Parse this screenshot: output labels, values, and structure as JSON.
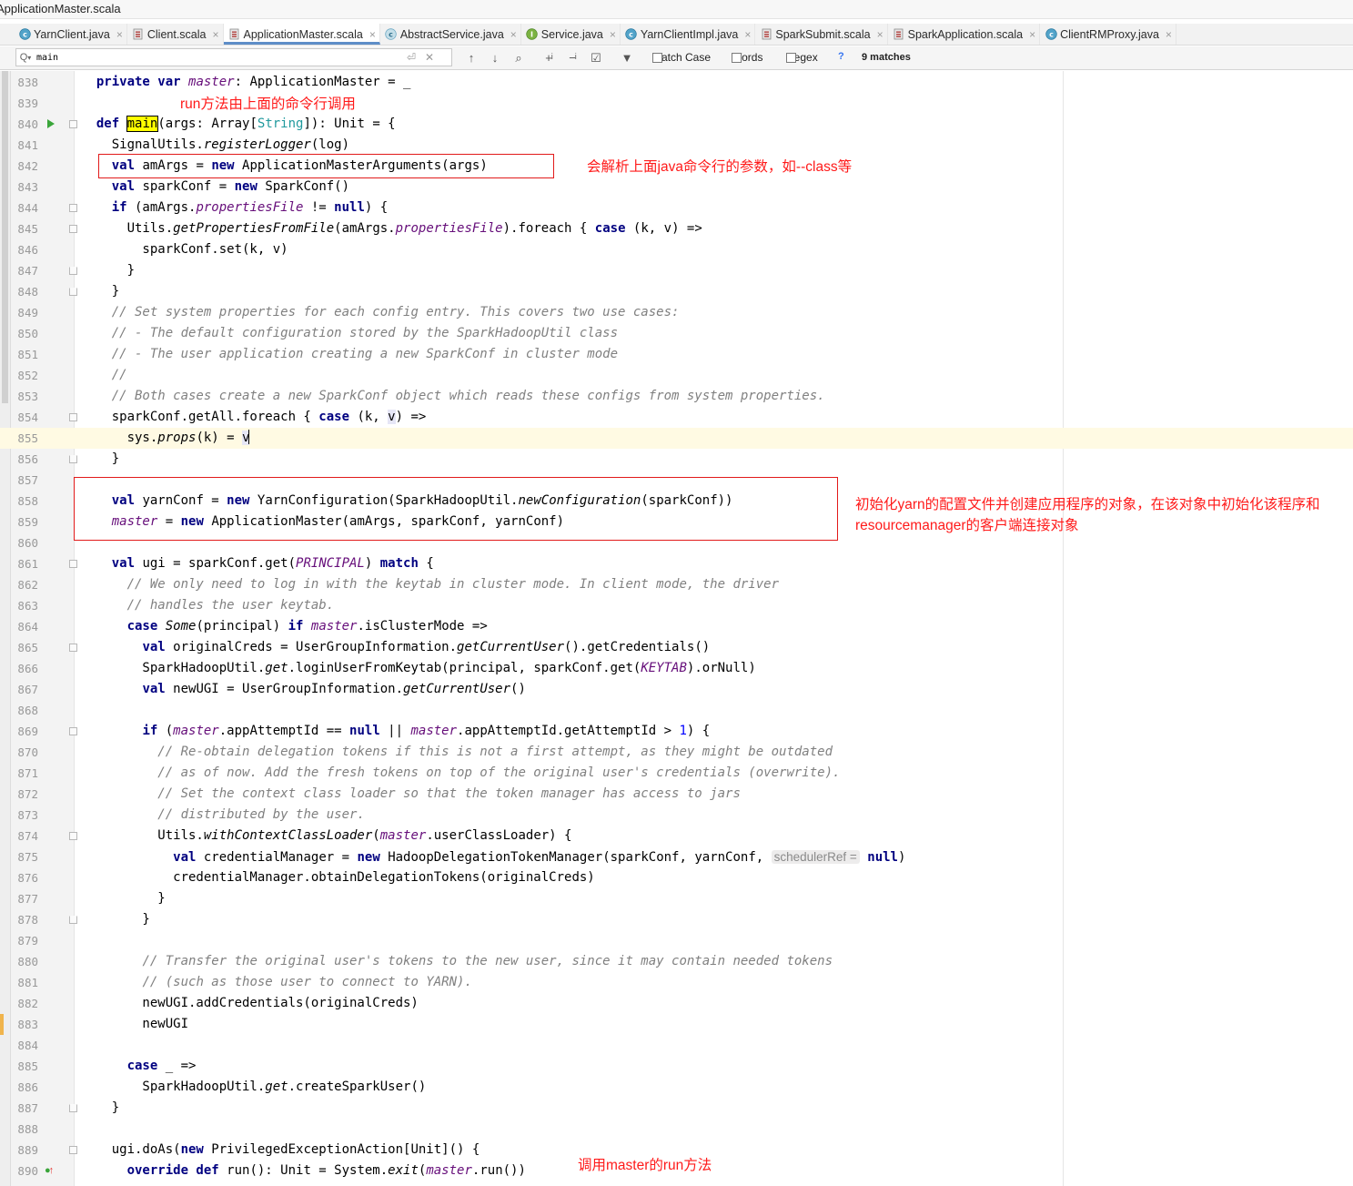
{
  "window": {
    "title": "ApplicationMaster.scala"
  },
  "tabs": [
    {
      "label": "YarnClient.java",
      "icon": "class-icon",
      "active": false
    },
    {
      "label": "Client.scala",
      "icon": "scala-file-icon",
      "active": false
    },
    {
      "label": "ApplicationMaster.scala",
      "icon": "scala-file-icon",
      "active": true
    },
    {
      "label": "AbstractService.java",
      "icon": "abstract-class-icon",
      "active": false
    },
    {
      "label": "Service.java",
      "icon": "interface-icon",
      "active": false
    },
    {
      "label": "YarnClientImpl.java",
      "icon": "class-icon",
      "active": false
    },
    {
      "label": "SparkSubmit.scala",
      "icon": "scala-file-icon",
      "active": false
    },
    {
      "label": "SparkApplication.scala",
      "icon": "scala-file-icon",
      "active": false
    },
    {
      "label": "ClientRMProxy.java",
      "icon": "class-icon",
      "active": false
    }
  ],
  "search": {
    "query": "main",
    "match_case_label": "Match Case",
    "words_label": "Words",
    "regex_label": "Regex",
    "help_label": "?",
    "matches_label": "9 matches"
  },
  "editor": {
    "current_line": 855,
    "lines": [
      {
        "n": "838",
        "html": "  <span class=\"kw\">private var</span> <span class=\"mem\">master</span>: ApplicationMaster = _"
      },
      {
        "n": "839",
        "html": ""
      },
      {
        "n": "840",
        "html": "  <span class=\"kw\">def</span> <span class=\"hl\">main</span>(args: Array[<span class=\"ty\">String</span>]): Unit = {"
      },
      {
        "n": "841",
        "html": "    SignalUtils.<span class=\"fn\">registerLogger</span>(log)"
      },
      {
        "n": "842",
        "html": "    <span class=\"kw\">val</span> amArgs = <span class=\"kw\">new</span> ApplicationMasterArguments(args)"
      },
      {
        "n": "843",
        "html": "    <span class=\"kw\">val</span> sparkConf = <span class=\"kw\">new</span> SparkConf()"
      },
      {
        "n": "844",
        "html": "    <span class=\"kw\">if</span> (amArgs.<span class=\"mem\">propertiesFile</span> != <span class=\"kw\">null</span>) {"
      },
      {
        "n": "845",
        "html": "      Utils.<span class=\"fn\">getPropertiesFromFile</span>(amArgs.<span class=\"mem\">propertiesFile</span>).foreach { <span class=\"kw\">case</span> (k, v) =>"
      },
      {
        "n": "846",
        "html": "        sparkConf.set(k, v)"
      },
      {
        "n": "847",
        "html": "      }"
      },
      {
        "n": "848",
        "html": "    }"
      },
      {
        "n": "849",
        "html": "    <span class=\"cm\">// Set system properties for each config entry. This covers two use cases:</span>"
      },
      {
        "n": "850",
        "html": "    <span class=\"cm\">// - The default configuration stored by the SparkHadoopUtil class</span>"
      },
      {
        "n": "851",
        "html": "    <span class=\"cm\">// - The user application creating a new SparkConf in cluster mode</span>"
      },
      {
        "n": "852",
        "html": "    <span class=\"cm\">//</span>"
      },
      {
        "n": "853",
        "html": "    <span class=\"cm\">// Both cases create a new SparkConf object which reads these configs from system properties.</span>"
      },
      {
        "n": "854",
        "html": "    sparkConf.getAll.foreach { <span class=\"kw\">case</span> (k, <span class=\"vref\">v</span>) =>"
      },
      {
        "n": "855",
        "html": "      sys.<span class=\"fn\">props</span>(k) = <span class=\"vref\">v</span>"
      },
      {
        "n": "856",
        "html": "    }"
      },
      {
        "n": "857",
        "html": ""
      },
      {
        "n": "858",
        "html": "    <span class=\"kw\">val</span> yarnConf = <span class=\"kw\">new</span> YarnConfiguration(SparkHadoopUtil.<span class=\"fn\">newConfiguration</span>(sparkConf))"
      },
      {
        "n": "859",
        "html": "    <span class=\"mem\">master</span> = <span class=\"kw\">new</span> ApplicationMaster(amArgs, sparkConf, yarnConf)"
      },
      {
        "n": "860",
        "html": ""
      },
      {
        "n": "861",
        "html": "    <span class=\"kw\">val</span> ugi = sparkConf.get(<span class=\"mem\">PRINCIPAL</span>) <span class=\"kw\">match</span> {"
      },
      {
        "n": "862",
        "html": "      <span class=\"cm\">// We only need to log in with the keytab in cluster mode. In client mode, the driver</span>"
      },
      {
        "n": "863",
        "html": "      <span class=\"cm\">// handles the user keytab.</span>"
      },
      {
        "n": "864",
        "html": "      <span class=\"kw\">case</span> <span class=\"fn\">Some</span>(principal) <span class=\"kw\">if</span> <span class=\"mem\">master</span>.isClusterMode =>"
      },
      {
        "n": "865",
        "html": "        <span class=\"kw\">val</span> originalCreds = UserGroupInformation.<span class=\"fn\">getCurrentUser</span>().getCredentials()"
      },
      {
        "n": "866",
        "html": "        SparkHadoopUtil.<span class=\"fn\">get</span>.loginUserFromKeytab(principal, sparkConf.get(<span class=\"mem\">KEYTAB</span>).orNull)"
      },
      {
        "n": "867",
        "html": "        <span class=\"kw\">val</span> newUGI = UserGroupInformation.<span class=\"fn\">getCurrentUser</span>()"
      },
      {
        "n": "868",
        "html": ""
      },
      {
        "n": "869",
        "html": "        <span class=\"kw\">if</span> (<span class=\"mem\">master</span>.appAttemptId == <span class=\"kw\">null</span> || <span class=\"mem\">master</span>.appAttemptId.getAttemptId > <span class=\"num\">1</span>) {"
      },
      {
        "n": "870",
        "html": "          <span class=\"cm\">// Re-obtain delegation tokens if this is not a first attempt, as they might be outdated</span>"
      },
      {
        "n": "871",
        "html": "          <span class=\"cm\">// as of now. Add the fresh tokens on top of the original user's credentials (overwrite).</span>"
      },
      {
        "n": "872",
        "html": "          <span class=\"cm\">// Set the context class loader so that the token manager has access to jars</span>"
      },
      {
        "n": "873",
        "html": "          <span class=\"cm\">// distributed by the user.</span>"
      },
      {
        "n": "874",
        "html": "          Utils.<span class=\"fn\">withContextClassLoader</span>(<span class=\"mem\">master</span>.userClassLoader) {"
      },
      {
        "n": "875",
        "html": "            <span class=\"kw\">val</span> credentialManager = <span class=\"kw\">new</span> HadoopDelegationTokenManager(sparkConf, yarnConf, <span class=\"hint\">schedulerRef =</span> <span class=\"kw\">null</span>)"
      },
      {
        "n": "876",
        "html": "            credentialManager.obtainDelegationTokens(originalCreds)"
      },
      {
        "n": "877",
        "html": "          }"
      },
      {
        "n": "878",
        "html": "        }"
      },
      {
        "n": "879",
        "html": ""
      },
      {
        "n": "880",
        "html": "        <span class=\"cm\">// Transfer the original user's tokens to the new user, since it may contain needed tokens</span>"
      },
      {
        "n": "881",
        "html": "        <span class=\"cm\">// (such as those user to connect to YARN).</span>"
      },
      {
        "n": "882",
        "html": "        newUGI.addCredentials(originalCreds)"
      },
      {
        "n": "883",
        "html": "        newUGI"
      },
      {
        "n": "884",
        "html": ""
      },
      {
        "n": "885",
        "html": "      <span class=\"kw\">case</span> _ =>"
      },
      {
        "n": "886",
        "html": "        SparkHadoopUtil.<span class=\"fn\">get</span>.createSparkUser()"
      },
      {
        "n": "887",
        "html": "    }"
      },
      {
        "n": "888",
        "html": ""
      },
      {
        "n": "889",
        "html": "    ugi.doAs(<span class=\"kw\">new</span> PrivilegedExceptionAction[Unit]() {"
      },
      {
        "n": "890",
        "html": "      <span class=\"kw\">override def</span> run(): Unit = System.<span class=\"fn\">exit</span>(<span class=\"mem\">master</span>.run())"
      }
    ]
  },
  "annotations": {
    "note_run_called": "run方法由上面的命令行调用",
    "note_parse_args": "会解析上面java命令行的参数，如--class等",
    "note_yarn_init_1": "初始化yarn的配置文件并创建应用程序的对象，在该对象中初始化该程序和",
    "note_yarn_init_2": "resourcemanager的客户端连接对象",
    "note_call_run": "调用master的run方法",
    "box_color": "#e21a1a"
  },
  "colors": {
    "keyword": "#000080",
    "member": "#660e7a",
    "comment": "#808080",
    "type_param": "#20999d",
    "number": "#0000ff",
    "search_highlight": "#ffff00",
    "current_line": "#fffae3",
    "annotation_red": "#ff1a1a"
  }
}
